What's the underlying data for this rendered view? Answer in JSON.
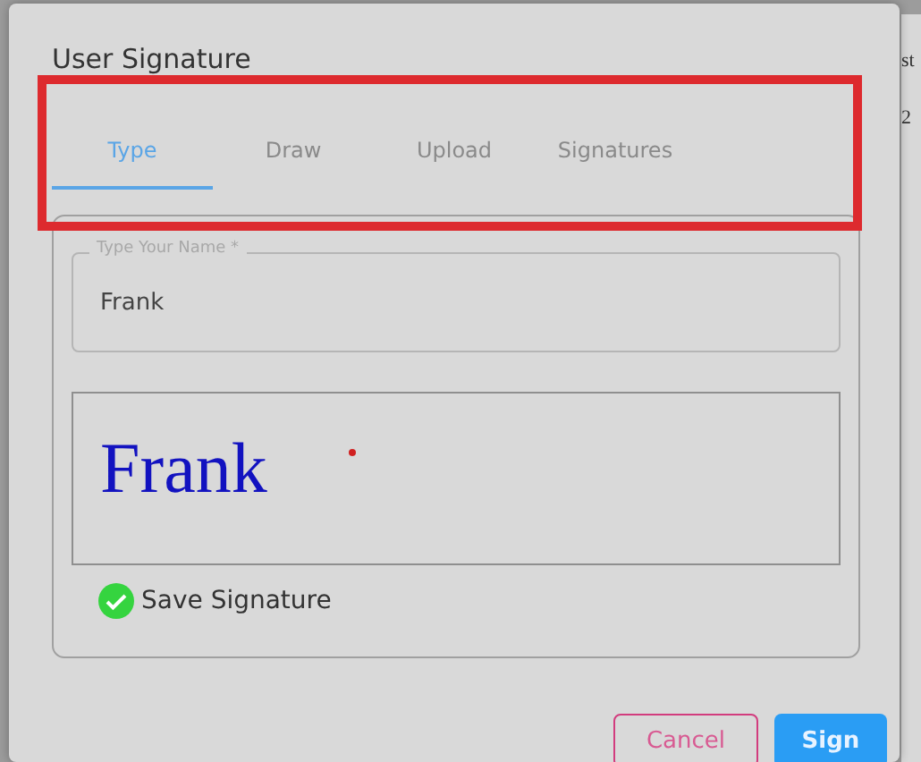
{
  "background_page": {
    "texts": [
      "st",
      "2"
    ]
  },
  "dialog": {
    "title": "User Signature",
    "tabs": [
      {
        "label": "Type",
        "selected": true
      },
      {
        "label": "Draw",
        "selected": false
      },
      {
        "label": "Upload",
        "selected": false
      },
      {
        "label": "Signatures",
        "selected": false
      }
    ],
    "name_field": {
      "label": "Type Your Name *",
      "value": "Frank"
    },
    "signature_preview": "Frank",
    "save_signature": {
      "label": "Save Signature",
      "checked": true
    },
    "buttons": [
      {
        "label": "Cancel",
        "kind": "secondary"
      },
      {
        "label": "Sign",
        "kind": "primary"
      }
    ]
  },
  "annotation": {
    "kind": "highlight"
  }
}
